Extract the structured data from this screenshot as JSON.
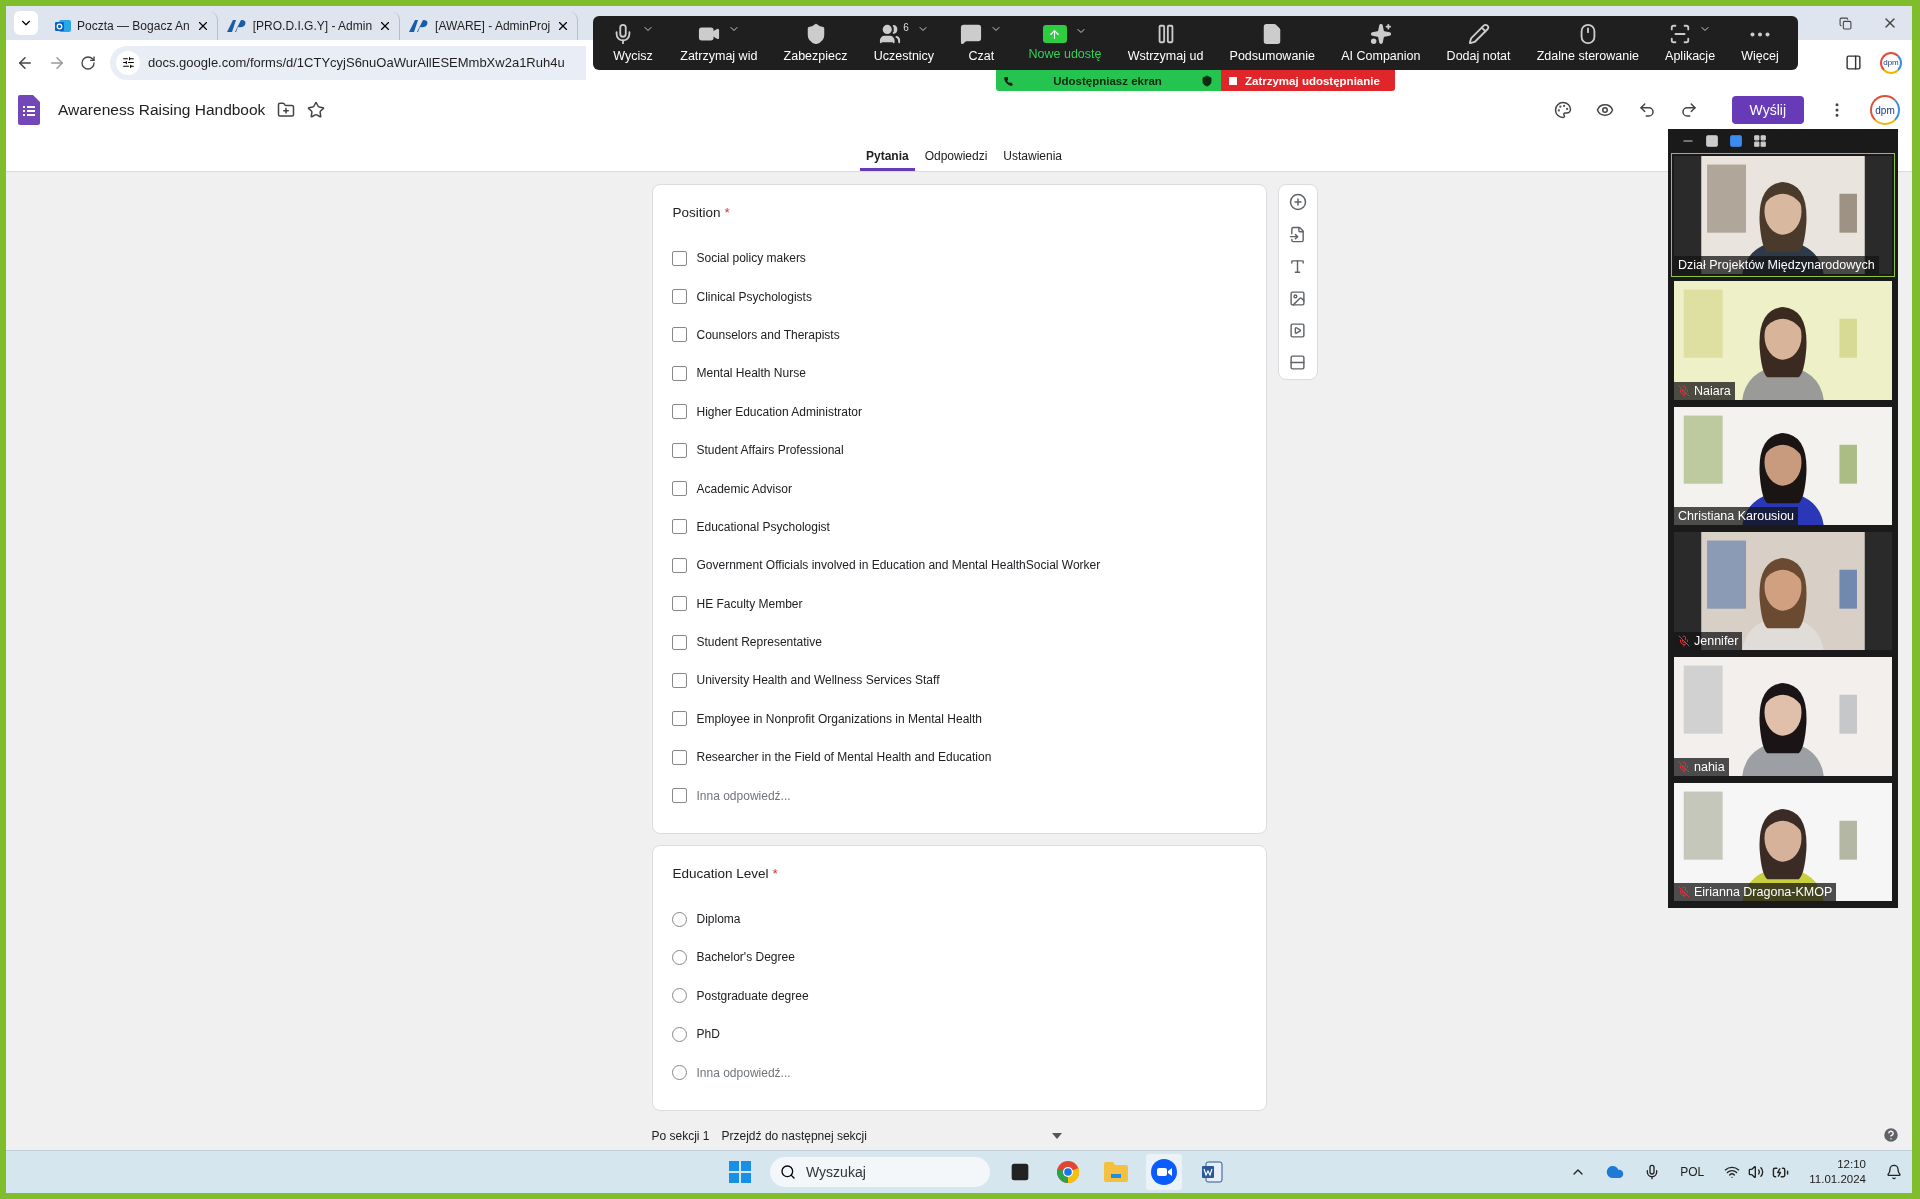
{
  "browser": {
    "tabs": [
      {
        "title": "Poczta — Bogacz An",
        "selected": false
      },
      {
        "title": "[PRO.D.I.G.Y] - Admin",
        "selected": false
      },
      {
        "title": "[AWARE] - AdminProj",
        "selected": false
      }
    ],
    "url": "docs.google.com/forms/d/1CTYcyjS6nuOaWurAllESEMmbXw2a1Ruh4u",
    "profile": "dpm"
  },
  "zoom_toolbar": {
    "items": [
      {
        "kind": "mic",
        "label": "Wycisz",
        "menu": true
      },
      {
        "kind": "video",
        "label": "Zatrzymaj wid",
        "menu": true
      },
      {
        "kind": "security",
        "label": "Zabezpiecz",
        "menu": false
      },
      {
        "kind": "participants",
        "label": "Uczestnicy",
        "badge": "6",
        "menu": true
      },
      {
        "kind": "chat",
        "label": "Czat",
        "menu": true
      },
      {
        "kind": "share",
        "label": "Nowe udostę",
        "menu": true
      },
      {
        "kind": "pause",
        "label": "Wstrzymaj ud",
        "menu": false
      },
      {
        "kind": "summary",
        "label": "Podsumowanie",
        "menu": false
      },
      {
        "kind": "ai",
        "label": "AI Companion",
        "menu": false
      },
      {
        "kind": "note",
        "label": "Dodaj notat",
        "menu": false
      },
      {
        "kind": "remote",
        "label": "Zdalne sterowanie",
        "menu": false
      },
      {
        "kind": "apps",
        "label": "Aplikacje",
        "menu": true
      },
      {
        "kind": "more",
        "label": "Więcej",
        "menu": false
      }
    ]
  },
  "share_banner": {
    "status": "Udostępniasz ekran",
    "stop": "Zatrzymaj udostępnianie"
  },
  "form_header": {
    "title": "Awareness Raising Handbook",
    "send_button": "Wyślij",
    "avatar": "dpm"
  },
  "form_tabs": [
    {
      "label": "Pytania",
      "selected": true
    },
    {
      "label": "Odpowiedzi",
      "selected": false
    },
    {
      "label": "Ustawienia",
      "selected": false
    }
  ],
  "questions": [
    {
      "title": "Position",
      "required_mark": "*",
      "kind": "checkbox",
      "options": [
        {
          "label": "Social policy makers",
          "checked": false,
          "other": false
        },
        {
          "label": "Clinical Psychologists",
          "checked": false,
          "other": false
        },
        {
          "label": "Counselors and Therapists",
          "checked": false,
          "other": false
        },
        {
          "label": "Mental Health Nurse",
          "checked": false,
          "other": false
        },
        {
          "label": "Higher Education Administrator",
          "checked": false,
          "other": false
        },
        {
          "label": "Student Affairs Professional",
          "checked": false,
          "other": false
        },
        {
          "label": "Academic Advisor",
          "checked": false,
          "other": false
        },
        {
          "label": "Educational Psychologist",
          "checked": false,
          "other": false
        },
        {
          "label": "Government Officials involved in Education and Mental HealthSocial Worker",
          "checked": false,
          "other": false
        },
        {
          "label": "HE Faculty Member",
          "checked": false,
          "other": false
        },
        {
          "label": "Student Representative",
          "checked": false,
          "other": false
        },
        {
          "label": "University Health and Wellness Services Staff",
          "checked": false,
          "other": false
        },
        {
          "label": "Employee in Nonprofit Organizations in Mental Health",
          "checked": false,
          "other": false
        },
        {
          "label": "Researcher in the Field of Mental Health and Education",
          "checked": false,
          "other": false
        },
        {
          "label": "Inna odpowiedź...",
          "checked": false,
          "other": true
        }
      ]
    },
    {
      "title": "Education Level",
      "required_mark": "*",
      "kind": "radio",
      "options": [
        {
          "label": "Diploma",
          "checked": false,
          "other": false
        },
        {
          "label": "Bachelor's Degree",
          "checked": false,
          "other": false
        },
        {
          "label": "Postgraduate degree",
          "checked": false,
          "other": false
        },
        {
          "label": "PhD",
          "checked": false,
          "other": false
        },
        {
          "label": "Inna odpowiedź...",
          "checked": false,
          "other": true
        }
      ]
    }
  ],
  "section_footer": {
    "label": "Po sekcji 1",
    "value": "Przejdź do następnej sekcji"
  },
  "video_panel": {
    "view_modes": [
      {
        "kind": "minimize",
        "selected": false
      },
      {
        "kind": "single",
        "selected": false
      },
      {
        "kind": "strip",
        "selected": true
      },
      {
        "kind": "grid",
        "selected": false
      }
    ],
    "participants": [
      {
        "name": "Dział Projektów Międzynarodowych",
        "muted": false,
        "speaking": true
      },
      {
        "name": "Naiara",
        "muted": true,
        "speaking": false
      },
      {
        "name": "Christiana Karousiou",
        "muted": false,
        "speaking": false
      },
      {
        "name": "Jennifer",
        "muted": true,
        "speaking": false
      },
      {
        "name": "nahia",
        "muted": true,
        "speaking": false
      },
      {
        "name": "Eirianna Dragona-KMOP",
        "muted": true,
        "speaking": false
      }
    ]
  },
  "taskbar": {
    "search_placeholder": "Wyszukaj",
    "language": "POL",
    "time": "12:10",
    "date": "11.01.2024"
  }
}
